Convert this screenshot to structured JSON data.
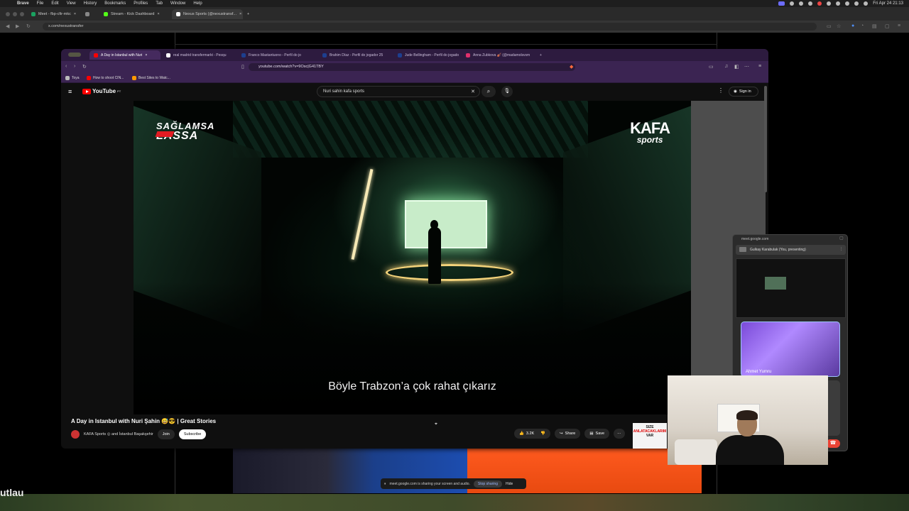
{
  "menubar": {
    "apple": "",
    "app": "Brave",
    "items": [
      "File",
      "Edit",
      "View",
      "History",
      "Bookmarks",
      "Profiles",
      "Tab",
      "Window",
      "Help"
    ],
    "clock": "Fri Apr 24  21:13"
  },
  "outer_browser": {
    "tabs": [
      {
        "label": "Meet - fbp-cfir-mkc",
        "color": "#1aa260"
      },
      {
        "label": "",
        "color": "#888888"
      },
      {
        "label": "Stream - Kick Dashboard",
        "color": "#53fc18"
      },
      {
        "label": "Nexus Sports (@nexustransf...",
        "color": "#ffffff"
      }
    ],
    "new_tab": "+",
    "url": "x.com/nexustransfer"
  },
  "inner_browser": {
    "tabs": [
      {
        "label": "A Day in Istanbul with Nuri",
        "color": "#ff0000"
      },
      {
        "label": "real madrid transfermarkt - Pesqu",
        "color": "#4285f4"
      },
      {
        "label": "Franco Mastantuono - Perfil do jo",
        "color": "#1d3f8f"
      },
      {
        "label": "Brahim Díaz - Perfil do jogador 25",
        "color": "#1d3f8f"
      },
      {
        "label": "Jude Bellingham - Perfil do jogado",
        "color": "#1d3f8f"
      },
      {
        "label": "Anna Zubkova 🎻 (@madamolsvsm",
        "color": "#e1306c"
      }
    ],
    "new_tab": "+",
    "url": "youtube.com/watch?v=9Osc|G41TBY",
    "bookmarks": [
      "Toya",
      "How to shoot CIN...",
      "Best Sites to Watc..."
    ]
  },
  "youtube": {
    "logo": "YouTube",
    "region": "PT",
    "search_value": "Nuri sahin kafa sports",
    "clear_icon": "✕",
    "search_icon": "⌕",
    "mic_icon": "🎙",
    "more_icon": "⋮",
    "signin_label": "Sign in",
    "video": {
      "brand_left_line1": "SAĞLAMSA",
      "brand_left_line2": "LASSA",
      "brand_right_line1": "KAFA",
      "brand_right_line2": "sports",
      "subtitle": "Böyle Trabzon’a çok rahat çıkarız"
    },
    "title": "A Day in Istanbul with Nuri Şahin 😅😎 | Great Stories",
    "channel": "KAFA Sports ◎ and İstanbul Başakşehir",
    "join_label": "Join",
    "subscribe_label": "Subscribe",
    "likes": "3.2K",
    "share_label": "Share",
    "save_label": "Save",
    "more_label": "···",
    "ad_line1": "SIZE",
    "ad_line2": "ANLATACAKLARIM",
    "ad_line3": "VAR"
  },
  "meet": {
    "url": "meet.google.com",
    "presenting": "Gulkay Karabulak (You, presenting)",
    "tile_name": "Ahmet Yumru"
  },
  "sharebar": {
    "text": "meet.google.com is sharing your screen and audio.",
    "stop_label": "Stop sharing",
    "hide_label": "Hide"
  },
  "background_text": "utlau"
}
